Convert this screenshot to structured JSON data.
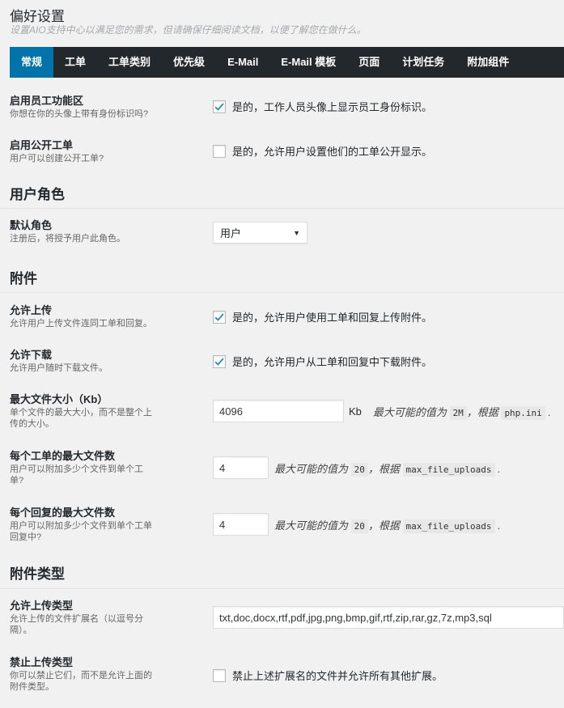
{
  "header": {
    "title": "偏好设置",
    "subtitle": "设置AIO支持中心以满足您的需求，但请确保仔细阅读文档，以便了解您在做什么。"
  },
  "tabs": [
    {
      "label": "常规",
      "active": true
    },
    {
      "label": "工单"
    },
    {
      "label": "工单类别"
    },
    {
      "label": "优先级"
    },
    {
      "label": "E-Mail"
    },
    {
      "label": "E-Mail 模板"
    },
    {
      "label": "页面"
    },
    {
      "label": "计划任务"
    },
    {
      "label": "附加组件"
    }
  ],
  "general": {
    "staff_id": {
      "title": "启用员工功能区",
      "desc": "你想在你的头像上带有身份标识吗?",
      "option": "是的，工作人员头像上显示员工身份标识。",
      "checked": true
    },
    "public_tickets": {
      "title": "启用公开工单",
      "desc": "用户可以创建公开工单?",
      "option": "是的，允许用户设置他们的工单公开显示。",
      "checked": false
    }
  },
  "user_roles": {
    "heading": "用户角色",
    "default_role": {
      "title": "默认角色",
      "desc": "注册后，将授予用户此角色。",
      "value": "用户"
    }
  },
  "attachments": {
    "heading": "附件",
    "allow_upload": {
      "title": "允许上传",
      "desc": "允许用户上传文件连同工单和回复。",
      "option": "是的，允许用户使用工单和回复上传附件。",
      "checked": true
    },
    "allow_download": {
      "title": "允许下载",
      "desc": "允许用户随时下载文件。",
      "option": "是的，允许用户从工单和回复中下载附件。",
      "checked": true
    },
    "max_size": {
      "title": "最大文件大小（Kb）",
      "desc_1": "单个文件的最大大小，而不是整个上",
      "desc_2": "传的大小。",
      "value": "4096",
      "unit": "Kb",
      "hint_prefix": "最大可能的值为",
      "hint_value": "2M",
      "hint_mid": "，根据",
      "hint_code": "php.ini",
      "hint_suffix": "."
    },
    "max_per_ticket": {
      "title": "每个工单的最大文件数",
      "desc_1": "用户可以附加多少个文件到单个工",
      "desc_2": "单?",
      "value": "4",
      "hint_prefix": "最大可能的值为",
      "hint_value": "20",
      "hint_mid": "，根据",
      "hint_code": "max_file_uploads",
      "hint_suffix": "."
    },
    "max_per_reply": {
      "title": "每个回复的最大文件数",
      "desc_1": "用户可以附加多少个文件到单个工单",
      "desc_2": "回复中?",
      "value": "4",
      "hint_prefix": "最大可能的值为",
      "hint_value": "20",
      "hint_mid": "，根据",
      "hint_code": "max_file_uploads",
      "hint_suffix": "."
    }
  },
  "attachment_types": {
    "heading": "附件类型",
    "allowed": {
      "title": "允许上传类型",
      "desc_1": "允许上传的文件扩展名（以逗号分",
      "desc_2": "隔）。",
      "value": "txt,doc,docx,rtf,pdf,jpg,png,bmp,gif,rtf,zip,rar,gz,7z,mp3,sql"
    },
    "forbid": {
      "title": "禁止上传类型",
      "desc_1": "你可以禁止它们，而不是允许上面的",
      "desc_2": "附件类型。",
      "option": "禁止上述扩展名的文件并允许所有其他扩展。",
      "checked": false
    }
  },
  "colors": {
    "tab_bar": "#23282d",
    "tab_active": "#0073aa",
    "checkmark": "#1e8cbe",
    "background": "#f1f1f1"
  }
}
